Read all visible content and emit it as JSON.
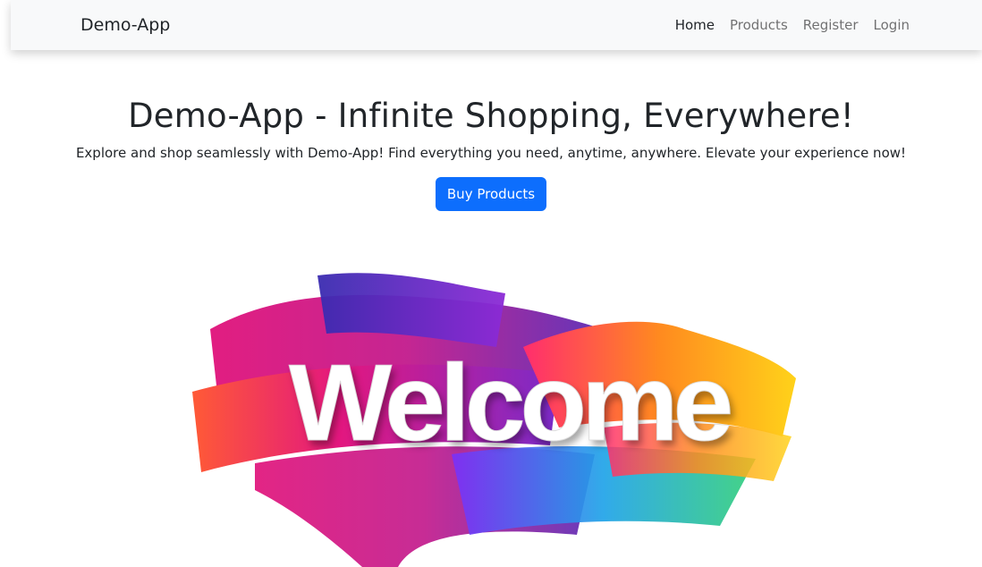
{
  "navbar": {
    "brand": "Demo-App",
    "links": [
      {
        "label": "Home",
        "active": true
      },
      {
        "label": "Products",
        "active": false
      },
      {
        "label": "Register",
        "active": false
      },
      {
        "label": "Login",
        "active": false
      }
    ]
  },
  "hero": {
    "title": "Demo-App - Infinite Shopping, Everywhere!",
    "subtitle": "Explore and shop seamlessly with Demo-App! Find everything you need, anytime, anywhere. Elevate your experience now!",
    "cta_label": "Buy Products"
  },
  "banner": {
    "text": "Welcome"
  },
  "colors": {
    "primary": "#0d6efd",
    "navbar_bg": "#f8f9fa",
    "text": "#212529"
  }
}
